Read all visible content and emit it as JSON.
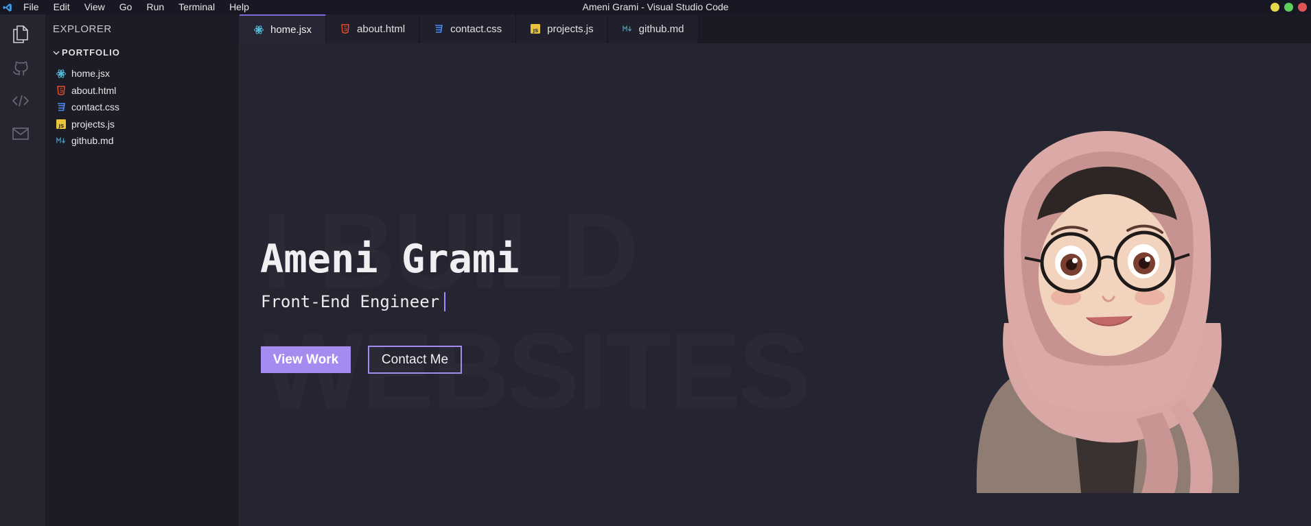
{
  "window": {
    "title": "Ameni Grami - Visual Studio Code",
    "traffic_colors": [
      "#e6d84b",
      "#5ccf5c",
      "#e05555"
    ]
  },
  "menu": {
    "items": [
      "File",
      "Edit",
      "View",
      "Go",
      "Run",
      "Terminal",
      "Help"
    ]
  },
  "activity_bar": {
    "icons": [
      "files-icon",
      "github-icon",
      "code-icon",
      "mail-icon"
    ]
  },
  "explorer": {
    "title": "EXPLORER",
    "folder": "PORTFOLIO",
    "files": [
      {
        "name": "home.jsx",
        "icon": "react-icon",
        "color": "#61dafb"
      },
      {
        "name": "about.html",
        "icon": "html-icon",
        "color": "#e34c26"
      },
      {
        "name": "contact.css",
        "icon": "css-icon",
        "color": "#2965f1"
      },
      {
        "name": "projects.js",
        "icon": "js-icon",
        "color": "#f0db4f"
      },
      {
        "name": "github.md",
        "icon": "markdown-icon",
        "color": "#519aba"
      }
    ]
  },
  "tabs": [
    {
      "label": "home.jsx",
      "icon": "react-icon",
      "active": true
    },
    {
      "label": "about.html",
      "icon": "html-icon",
      "active": false
    },
    {
      "label": "contact.css",
      "icon": "css-icon",
      "active": false
    },
    {
      "label": "projects.js",
      "icon": "js-icon",
      "active": false
    },
    {
      "label": "github.md",
      "icon": "markdown-icon",
      "active": false
    }
  ],
  "hero": {
    "background_line1": "I BUILD",
    "background_line2": "WEBSITES",
    "name": "Ameni Grami",
    "role": "Front-End Engineer",
    "primary_button": "View Work",
    "secondary_button": "Contact Me",
    "accent": "#a58bef"
  }
}
